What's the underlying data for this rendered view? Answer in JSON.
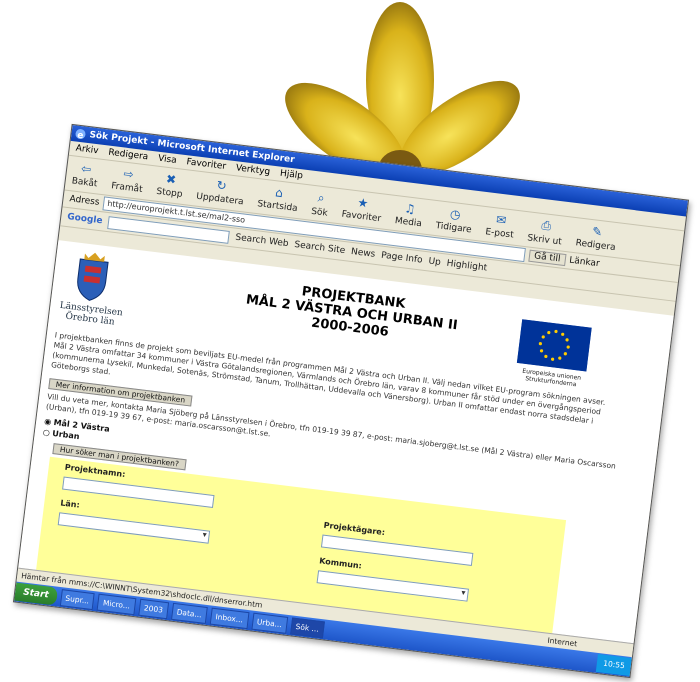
{
  "window": {
    "title": "Sök Projekt - Microsoft Internet Explorer"
  },
  "menu": [
    "Arkiv",
    "Redigera",
    "Visa",
    "Favoriter",
    "Verktyg",
    "Hjälp"
  ],
  "toolbar": [
    "Bakåt",
    "Framåt",
    "Stopp",
    "Uppdatera",
    "Startsida",
    "Sök",
    "Favoriter",
    "Media",
    "Tidigare",
    "E-post",
    "Skriv ut",
    "Redigera"
  ],
  "address": {
    "label": "Adress",
    "value": "http://europrojekt.t.lst.se/mal2-sso",
    "go": "Gå till",
    "links": "Länkar"
  },
  "googlebar": {
    "logo": "Google",
    "buttons": [
      "Search Web",
      "Search Site",
      "News",
      "Page Info",
      "Up",
      "Highlight"
    ]
  },
  "page": {
    "lan_label": "Länsstyrelsen\nÖrebro län",
    "heading_line1": "PROJEKTBANK",
    "heading_line2": "MÅL 2 VÄSTRA OCH URBAN II",
    "heading_line3": "2000-2006",
    "eu_label": "Europeiska unionen Strukturfonderna",
    "intro": "I projektbanken finns de projekt som beviljats EU-medel från programmen Mål 2 Västra och Urban II. Välj nedan vilket EU-program sökningen avser. Mål 2 Västra omfattar 34 kommuner i Västra Götalandsregionen, Värmlands och Örebro län, varav 8 kommuner får stöd under en övergångsperiod (kommunerna Lysekil, Munkedal, Sotenäs, Strömstad, Tanum, Trollhättan, Uddevalla och Vänersborg). Urban II omfattar endast norra stadsdelar i Göteborgs stad.",
    "more_info_button": "Mer information om projektbanken",
    "contact": "Vill du veta mer, kontakta Maria Sjöberg på Länsstyrelsen i Örebro, tfn 019-19 39 87, e-post: maria.sjoberg@t.lst.se (Mål 2 Västra) eller Maria Oscarsson (Urban), tfn 019-19 39 67, e-post: maria.oscarsson@t.lst.se.",
    "email1": "maria.sjoberg@t.lst.se",
    "email2": "maria.oscarsson@t.lst.se",
    "radio1": "Mål 2 Västra",
    "radio2": "Urban",
    "search_help_button": "Hur söker man i projektbanken?",
    "form": {
      "projektnamn": "Projektnamn:",
      "projektagare": "Projektägare:",
      "lan": "Län:",
      "kommun": "Kommun:"
    }
  },
  "statusbar": {
    "text": "Hämtar från mms://C:\\WINNT\\System32\\shdoclc.dll/dnserror.htm",
    "zone": "Internet"
  },
  "taskbar": {
    "start": "Start",
    "tasks": [
      "Supr...",
      "Micro...",
      "2003",
      "Data...",
      "Inbox...",
      "Urba...",
      "Sök ..."
    ],
    "clock": "10:55"
  }
}
